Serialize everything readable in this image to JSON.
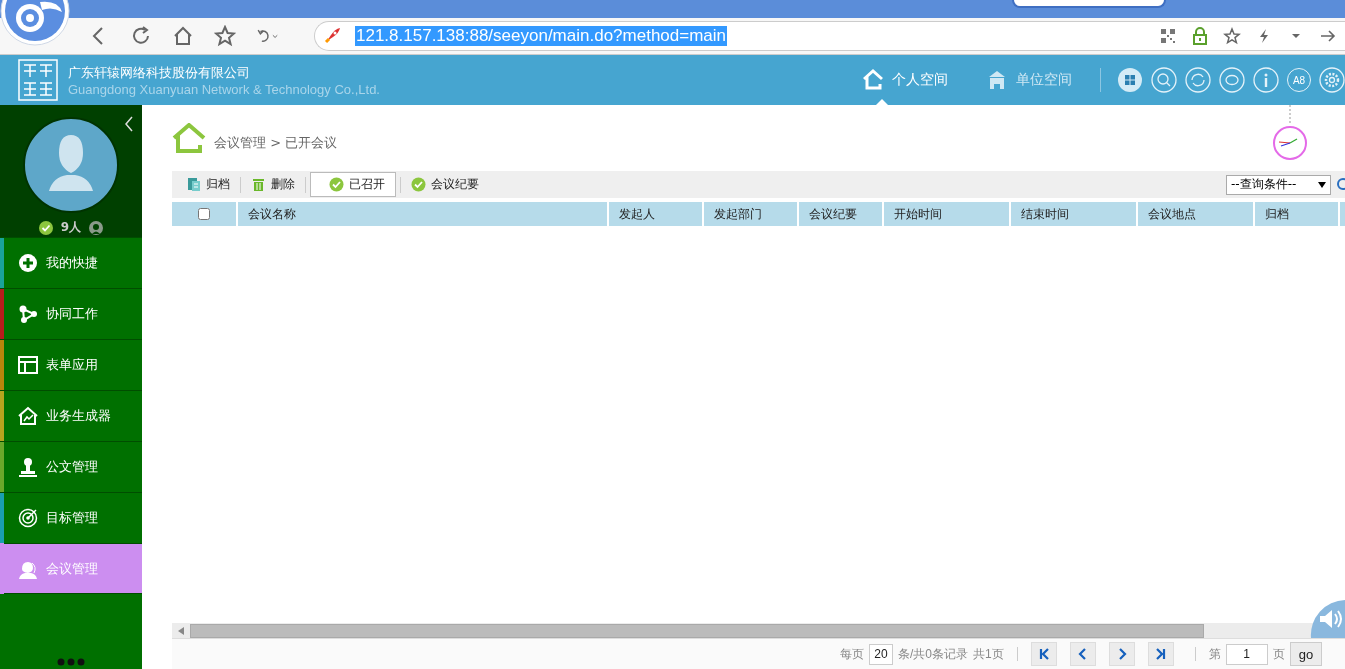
{
  "browser": {
    "url": "121.8.157.138:88/seeyon/main.do?method=main"
  },
  "header": {
    "company_name": "广东轩辕网络科技股份有限公司",
    "company_name_en": "Guangdong Xuanyuan Network & Technology Co.,Ltd.",
    "nav": [
      {
        "label": "个人空间",
        "selected": true
      },
      {
        "label": "单位空间",
        "selected": false
      }
    ],
    "tool_icons": [
      "A8"
    ]
  },
  "sidebar": {
    "online_count": "9人",
    "menu": [
      {
        "label": "我的快捷",
        "color": "#1aa39b",
        "selected": false
      },
      {
        "label": "协同工作",
        "color": "#b81c1c",
        "selected": false
      },
      {
        "label": "表单应用",
        "color": "#b8860b",
        "selected": false
      },
      {
        "label": "业务生成器",
        "color": "#b5a51e",
        "selected": false
      },
      {
        "label": "公文管理",
        "color": "#6aa82a",
        "selected": false
      },
      {
        "label": "目标管理",
        "color": "#1a9fb0",
        "selected": false
      },
      {
        "label": "会议管理",
        "color": "#cc8ef0",
        "selected": true
      }
    ]
  },
  "content": {
    "breadcrumb": "会议管理 > 已开会议",
    "toolbar": [
      {
        "label": "归档",
        "selected": false
      },
      {
        "label": "删除",
        "selected": false
      },
      {
        "label": "已召开",
        "selected": true
      },
      {
        "label": "会议纪要",
        "selected": false
      }
    ],
    "query": "--查询条件--",
    "table": {
      "select_all": {
        "checked": false
      },
      "columns": [
        "会议名称",
        "发起人",
        "发起部门",
        "会议纪要",
        "开始时间",
        "结束时间",
        "会议地点",
        "归档"
      ]
    },
    "pagination": {
      "per_page_label": "每页",
      "per_page": "20",
      "summary": "条/共0条记录",
      "total_pages": "共1页",
      "page_label": "第",
      "page": "1",
      "page_unit": "页",
      "go": "go"
    }
  }
}
